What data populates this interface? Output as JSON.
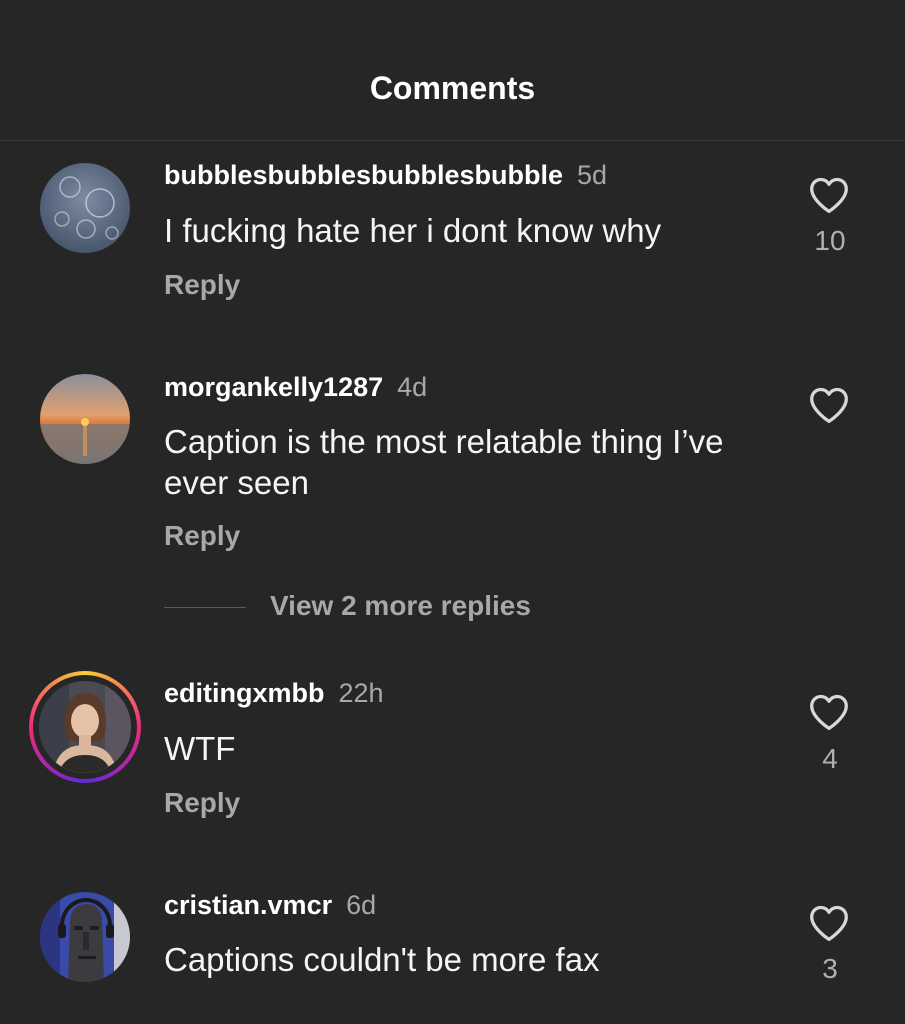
{
  "header": {
    "title": "Comments"
  },
  "comments": [
    {
      "username": "bubblesbubblesbubblesbubble",
      "time": "5d",
      "text": "I fucking hate her i dont know why",
      "reply_label": "Reply",
      "likes": "10"
    },
    {
      "username": "morgankelly1287",
      "time": "4d",
      "text": "Caption is the most relatable thing I’ve ever seen",
      "reply_label": "Reply",
      "likes": "",
      "view_replies": "View 2 more replies"
    },
    {
      "username": "editingxmbb",
      "time": "22h",
      "text": "WTF",
      "reply_label": "Reply",
      "likes": "4"
    },
    {
      "username": "cristian.vmcr",
      "time": "6d",
      "text": "Captions couldn't be more fax",
      "reply_label": "",
      "likes": "3"
    }
  ],
  "icons": {
    "like": "heart-outline-icon"
  },
  "colors": {
    "background": "#262626",
    "secondary_text": "#a8a8a8",
    "story_ring": "#d6249f"
  }
}
